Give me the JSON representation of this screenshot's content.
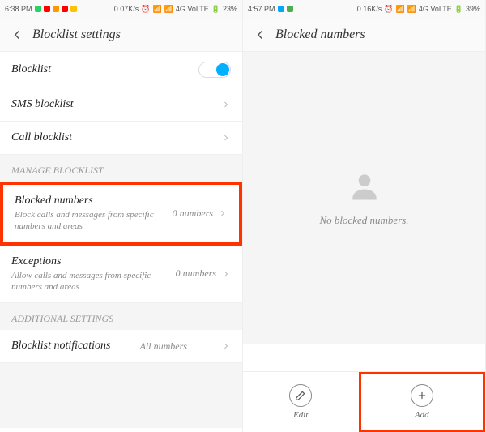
{
  "left": {
    "status": {
      "time": "6:38 PM",
      "speed": "0.07K/s",
      "network": "4G VoLTE",
      "battery": "23%"
    },
    "header": {
      "title": "Blocklist settings"
    },
    "rows": {
      "blocklist": "Blocklist",
      "sms": "SMS blocklist",
      "call": "Call blocklist"
    },
    "section1": "MANAGE BLOCKLIST",
    "blocked": {
      "title": "Blocked numbers",
      "sub": "Block calls and messages from specific numbers and areas",
      "value": "0 numbers"
    },
    "exceptions": {
      "title": "Exceptions",
      "sub": "Allow calls and messages from specific numbers and areas",
      "value": "0 numbers"
    },
    "section2": "ADDITIONAL SETTINGS",
    "notifications": {
      "title": "Blocklist notifications",
      "value": "All numbers"
    }
  },
  "right": {
    "status": {
      "time": "4:57 PM",
      "speed": "0.16K/s",
      "network": "4G VoLTE",
      "battery": "39%"
    },
    "header": {
      "title": "Blocked numbers"
    },
    "empty": "No blocked numbers.",
    "edit": "Edit",
    "add": "Add"
  }
}
